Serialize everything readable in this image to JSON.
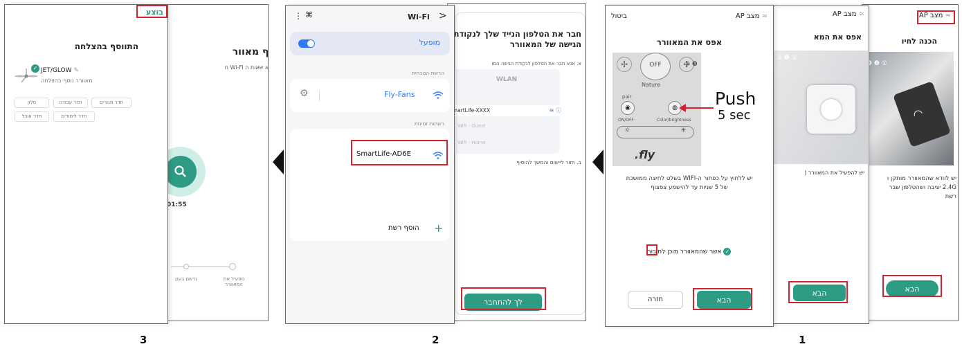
{
  "steps": [
    "1",
    "2",
    "3"
  ],
  "group1": {
    "back_card": {
      "title": "מצב AP",
      "header": "הכנה לחיו",
      "body": "יש לוודא שהמאוורר מותקן ו\n2.4G יציבה ושהטלפון שבר\nרשת",
      "next_label": "הבא"
    },
    "middle_card": {
      "title": "מצב AP",
      "header": "אפס את המא",
      "body": "יש להפעיל את המאוורר (",
      "next_label": "הבא"
    },
    "front_card": {
      "cancel_label": "ביטול",
      "title": "מצב AP",
      "header": "אפס את המאוורר",
      "remote_labels": {
        "off": "OFF",
        "nature": "Nature",
        "pair": "pair",
        "onoff": "ON/OFF",
        "color": "Color/brightness",
        "brand": ".fly"
      },
      "push_text": "Push",
      "sec_text": "5 sec",
      "instruction": "יש ללחוץ על כפתור ה-WIFI בשלט לחיצה ממושכת\nשל 5 שניות עד להישמע צפצוף",
      "confirm_label": "אשר שהמאוורר מוכן לחיבור",
      "back_label": "חזרה",
      "next_label": "הבא"
    }
  },
  "group2": {
    "back_card": {
      "header": "חבר את הטלפון הנייד שלך לנקודת\nהגישה של המאוורר",
      "step_a": "א. אנא חבר את הטלפון לנקודת הגישה המו",
      "wlan_label": "WLAN",
      "network_main": "SmartLife-XXXX",
      "network_guest": "Wifi - Guest",
      "network_home": "Wifi - Home",
      "step_b": "ב. חזור ליישום והמשך להוסיף",
      "connect_label": "לך להתחבר"
    },
    "front_card": {
      "title": "Wi-Fi",
      "enabled_label": "מופעל",
      "current_network_label": "הרשת הנוכחית",
      "current_network": "Fly-Fans",
      "available_label": "רשתות זמינות",
      "available_network": "SmartLife-AD6E",
      "add_network_label": "הוסף רשת",
      "add_icon": "+"
    }
  },
  "group3": {
    "back_card": {
      "header": "מוסיף מאוור",
      "body": "וודא שאות ה Wi-Fi ח",
      "timer": "01:55",
      "progress_step_1": "מפעיל את\nהמאוורר",
      "progress_step_2": "נרשם בענן"
    },
    "front_card": {
      "done_label": "בוצע",
      "header": "התווסף בהצלחה",
      "device_name": "JET/GLOW",
      "device_status": "מאוורר נוסף בהצלחה",
      "rooms": [
        "חדר מגורים",
        "חדר עבודה",
        "סלון",
        "חדר לימודים",
        "חדר אוכל"
      ]
    }
  }
}
